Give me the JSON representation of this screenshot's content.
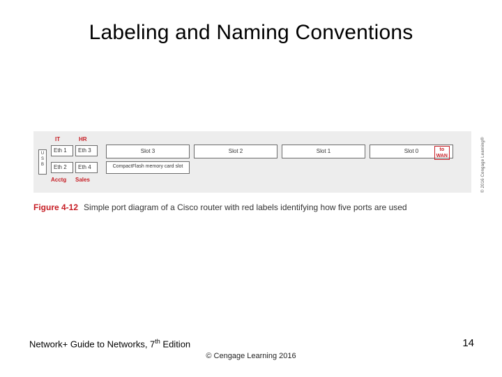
{
  "title": "Labeling and Naming Conventions",
  "diagram": {
    "topLabels": {
      "it": "IT",
      "hr": "HR"
    },
    "bottomLabels": {
      "acctg": "Acctg",
      "sales": "Sales"
    },
    "ports": {
      "eth1": "Eth 1",
      "eth2": "Eth 2",
      "eth3": "Eth 3",
      "eth4": "Eth 4"
    },
    "vert": {
      "a": "U",
      "b": "S",
      "c": "B"
    },
    "slots": {
      "s3": "Slot 3",
      "s2": "Slot 2",
      "s1": "Slot 1",
      "s0": "Slot 0"
    },
    "cflash": "CompactFlash memory card slot",
    "toWan": {
      "line1": "to",
      "line2": "WAN"
    },
    "credit": "© 2016 Cengage Learning®"
  },
  "caption": {
    "figNum": "Figure 4-12",
    "text": "Simple port diagram of a Cisco router with red labels identifying how five ports are used"
  },
  "footer": {
    "leftA": "Network+ Guide to Networks, 7",
    "leftSup": "th",
    "leftB": " Edition",
    "mid": "© Cengage Learning  2016",
    "pageNum": "14"
  }
}
